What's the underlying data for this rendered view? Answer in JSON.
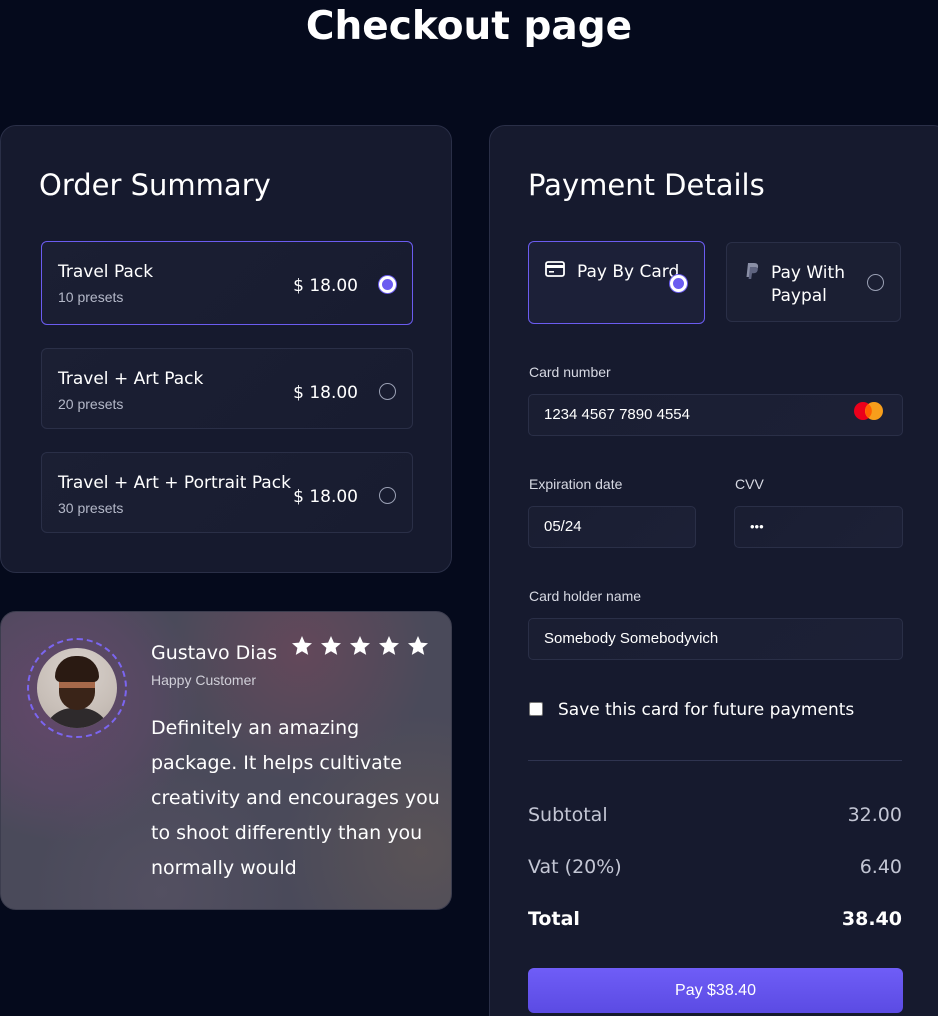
{
  "page": {
    "title": "Checkout page"
  },
  "order_summary": {
    "heading": "Order Summary",
    "packs": [
      {
        "name": "Travel Pack",
        "presets": "10 presets",
        "price": "$ 18.00",
        "selected": true
      },
      {
        "name": "Travel + Art Pack",
        "presets": "20 presets",
        "price": "$ 18.00",
        "selected": false
      },
      {
        "name": "Travel + Art + Portrait Pack",
        "presets": "30 presets",
        "price": "$ 18.00",
        "selected": false
      }
    ]
  },
  "testimonial": {
    "name": "Gustavo Dias",
    "role": "Happy Customer",
    "rating": 5,
    "quote": "Definitely an amazing package. It helps cultivate creativity and encourages you to shoot differently than you normally would"
  },
  "payment": {
    "heading": "Payment Details",
    "methods": [
      {
        "label": "Pay By Card",
        "icon": "credit-card-icon",
        "selected": true
      },
      {
        "label": "Pay With Paypal",
        "icon": "paypal-icon",
        "selected": false
      }
    ],
    "card_number": {
      "label": "Card number",
      "value": "1234 4567 7890 4554",
      "brand_icon": "mastercard-icon"
    },
    "expiration": {
      "label": "Expiration date",
      "value": "05/24"
    },
    "cvv": {
      "label": "CVV",
      "value": "•••"
    },
    "holder": {
      "label": "Card holder name",
      "value": "Somebody Somebodyvich"
    },
    "save_card": {
      "label": "Save this card for future payments",
      "checked": false
    },
    "subtotal": {
      "label": "Subtotal",
      "value": "32.00"
    },
    "vat": {
      "label": "Vat (20%)",
      "value": "6.40"
    },
    "total": {
      "label": "Total",
      "value": "38.40"
    },
    "pay_button": "Pay $38.40"
  },
  "colors": {
    "accent": "#6b5cf0",
    "background": "#050a1c",
    "panel": "#161a2e"
  }
}
